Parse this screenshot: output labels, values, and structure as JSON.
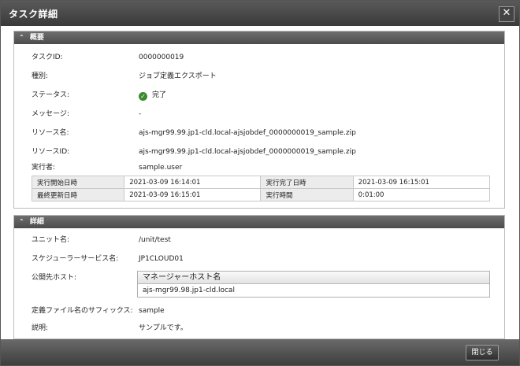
{
  "window": {
    "title": "タスク詳細",
    "close_glyph": "✕"
  },
  "overview": {
    "header": "概要",
    "fields": [
      {
        "label": "タスクID:",
        "value": "0000000019"
      },
      {
        "label": "種別:",
        "value": "ジョブ定義エクスポート"
      },
      {
        "label": "ステータス:",
        "value": "完了"
      },
      {
        "label": "メッセージ:",
        "value": "-"
      },
      {
        "label": "リソース名:",
        "value": "ajs-mgr99.99.jp1-cld.local-ajsjobdef_0000000019_sample.zip"
      },
      {
        "label": "リソースID:",
        "value": "ajs-mgr99.99.jp1-cld.local-ajsjobdef_0000000019_sample.zip"
      },
      {
        "label": "実行者:",
        "value": "sample.user"
      }
    ],
    "status_icon": "check-circle-icon",
    "status_color": "#3b8a2e",
    "times": [
      [
        {
          "label": "実行開始日時",
          "value": "2021-03-09 16:14:01"
        },
        {
          "label": "実行完了日時",
          "value": "2021-03-09 16:15:01"
        }
      ],
      [
        {
          "label": "最終更新日時",
          "value": "2021-03-09 16:15:01"
        },
        {
          "label": "実行時間",
          "value": "0:01:00"
        }
      ]
    ]
  },
  "details": {
    "header": "詳細",
    "unit_label": "ユニット名:",
    "unit_value": "/unit/test",
    "scheduler_label": "スケジューラーサービス名:",
    "scheduler_value": "JP1CLOUD01",
    "host_label": "公開先ホスト:",
    "host_column": "マネージャーホスト名",
    "host_value": "ajs-mgr99.98.jp1-cld.local",
    "suffix_label": "定義ファイル名のサフィックス:",
    "suffix_value": "sample",
    "desc_label": "説明:",
    "desc_value": "サンプルです。"
  },
  "footer": {
    "close_label": "閉じる"
  }
}
